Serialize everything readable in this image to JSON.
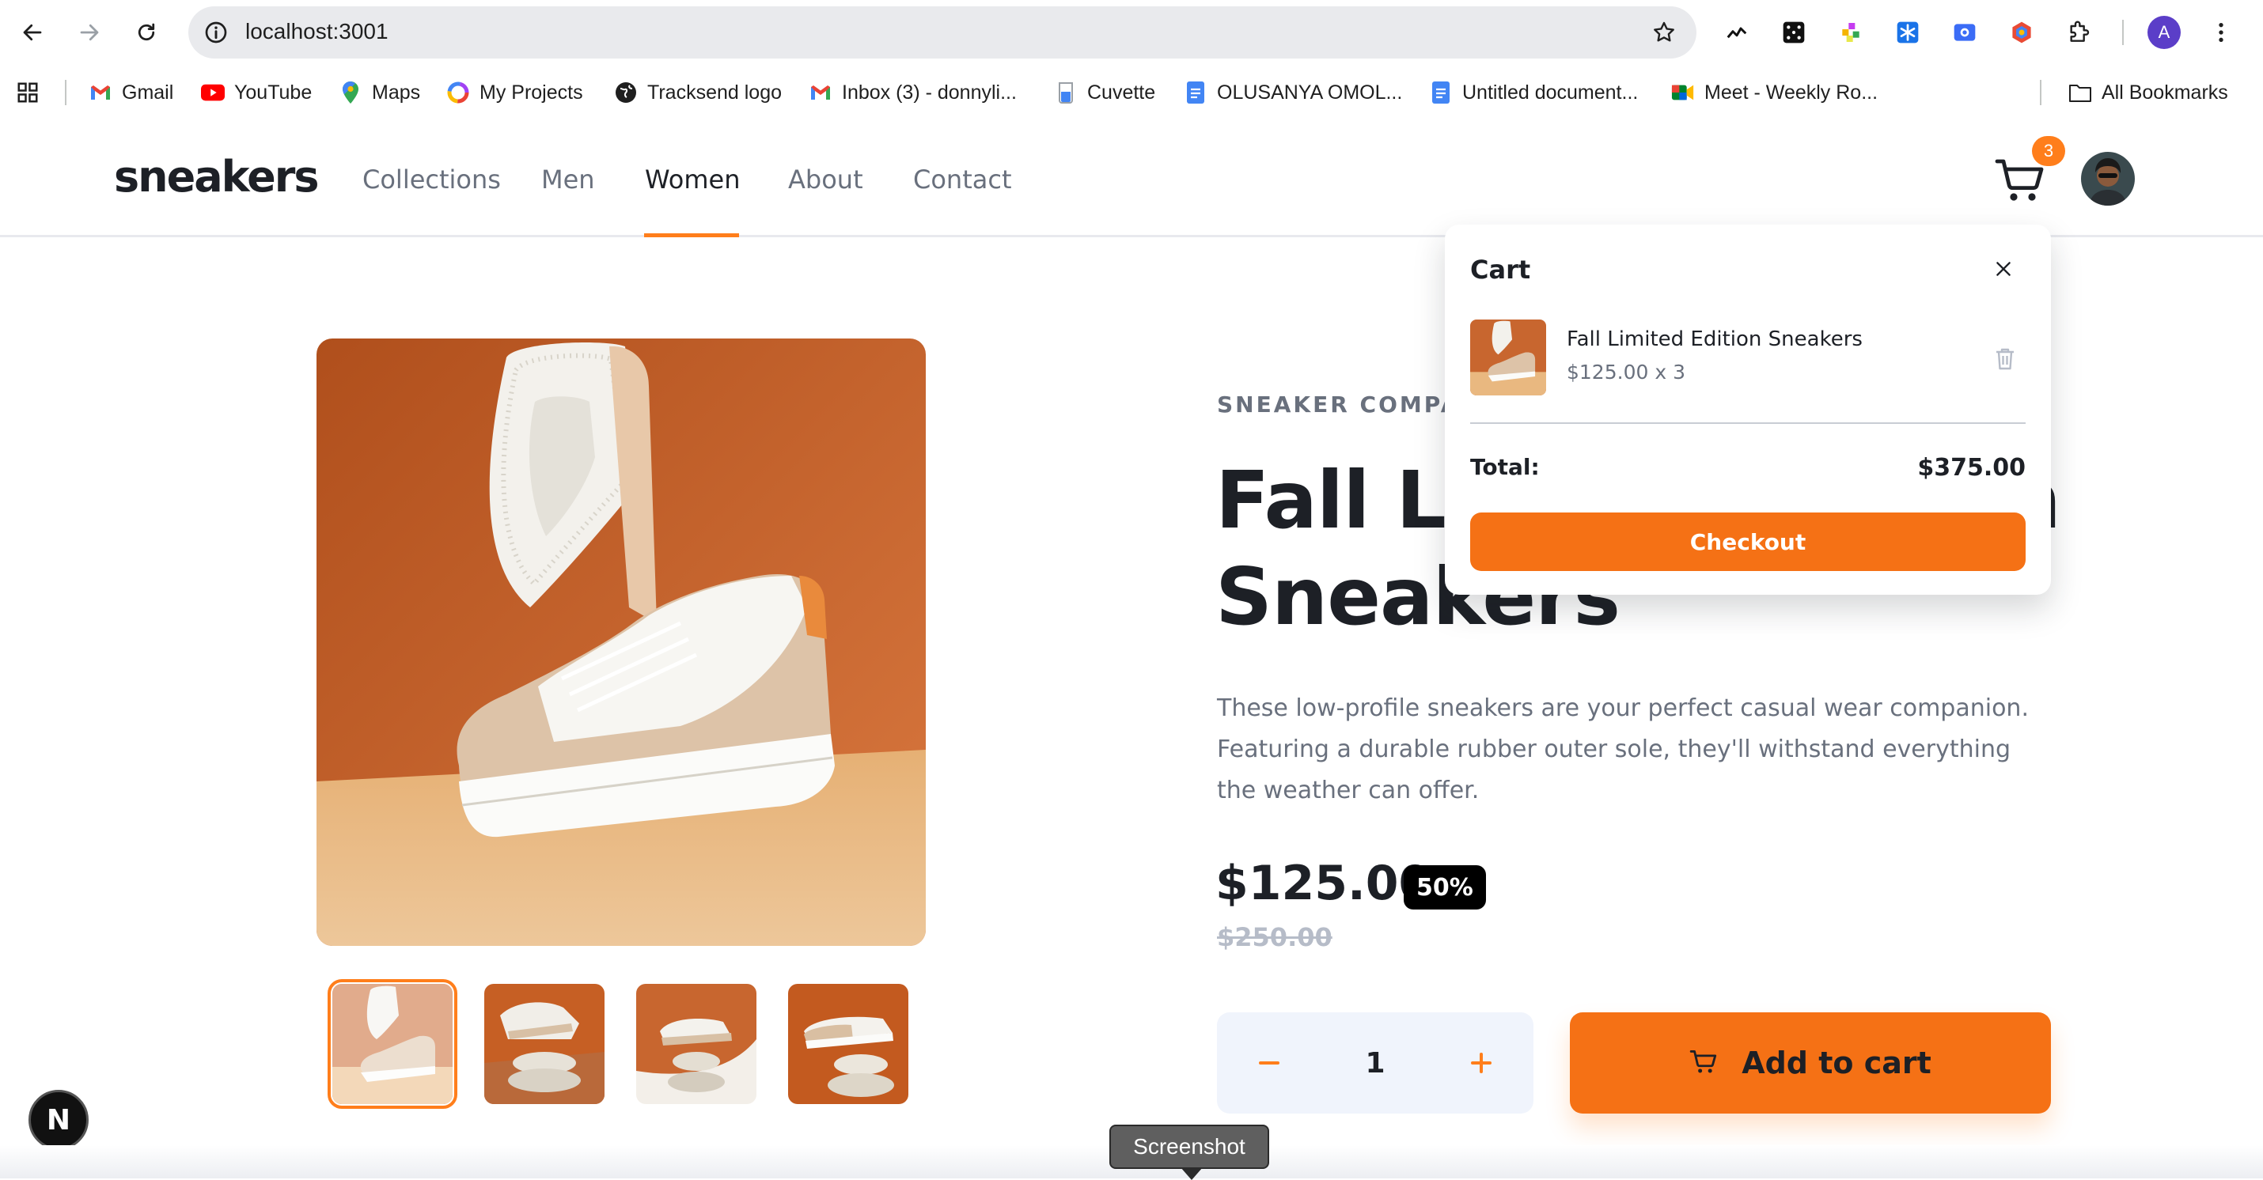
{
  "browser": {
    "url": "localhost:3001",
    "profile_initial": "A",
    "bookmarks": [
      {
        "label": "Gmail",
        "icon": "gmail-icon"
      },
      {
        "label": "YouTube",
        "icon": "youtube-icon"
      },
      {
        "label": "Maps",
        "icon": "maps-pin-icon"
      },
      {
        "label": "My Projects",
        "icon": "projects-ring-icon"
      },
      {
        "label": "Tracksend logo",
        "icon": "globe-icon"
      },
      {
        "label": "Inbox (3) - donnyli...",
        "icon": "gmail-icon"
      },
      {
        "label": "Cuvette",
        "icon": "cuvette-icon"
      },
      {
        "label": "OLUSANYA OMOL...",
        "icon": "docs-icon"
      },
      {
        "label": "Untitled document...",
        "icon": "docs-icon"
      },
      {
        "label": "Meet - Weekly Ro...",
        "icon": "meet-icon"
      }
    ],
    "all_bookmarks": "All Bookmarks"
  },
  "header": {
    "logo": "sneakers",
    "nav": [
      "Collections",
      "Men",
      "Women",
      "About",
      "Contact"
    ],
    "active_nav": "Women",
    "cart_count": "3"
  },
  "product": {
    "company": "SNEAKER COMPANY",
    "title_line1": "Fall Limited Edition",
    "title_line2": "Sneakers",
    "description": "These low-profile sneakers are your perfect casual wear companion. Featuring a durable rubber outer sole, they'll withstand everything the weather can offer.",
    "price": "$125.00",
    "discount": "50%",
    "old_price": "$250.00",
    "quantity": "1",
    "add_to_cart": "Add to cart"
  },
  "cart": {
    "title": "Cart",
    "item_name": "Fall Limited Edition Sneakers",
    "item_calc": "$125.00 x 3",
    "total_label": "Total:",
    "total_value": "$375.00",
    "checkout": "Checkout"
  },
  "overlay": {
    "framework_badge": "N",
    "tooltip": "Screenshot"
  },
  "colors": {
    "accent": "#ff7e1b",
    "button": "#f57115",
    "dark": "#1d2026",
    "muted": "#69707d"
  }
}
